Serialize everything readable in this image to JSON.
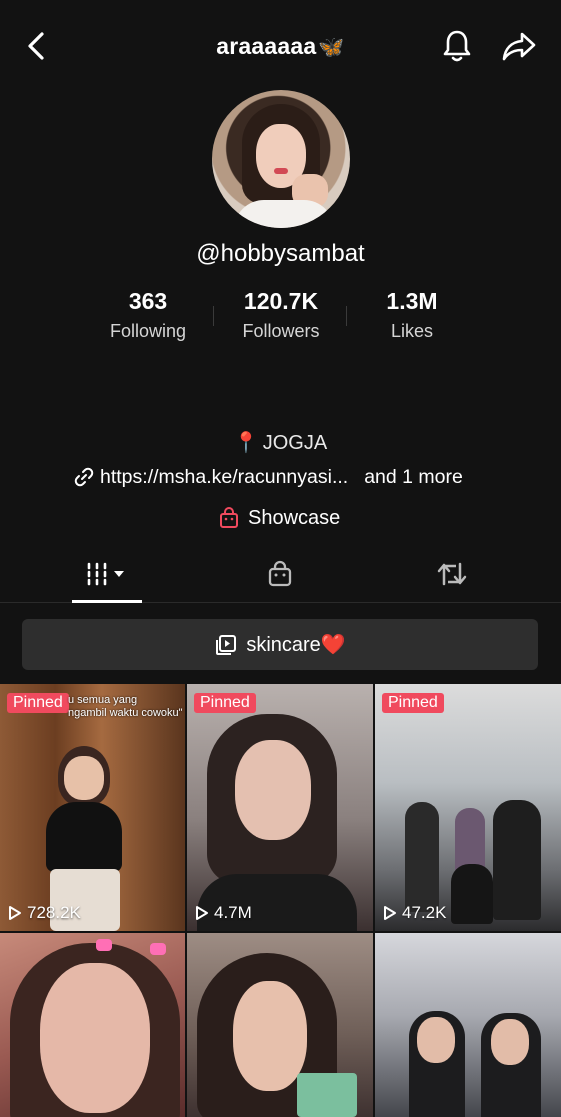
{
  "header": {
    "title": "araaaaaa",
    "title_emoji": "🦋",
    "back_icon": "chevron-left-icon",
    "bell_icon": "bell-icon",
    "share_icon": "share-arrow-icon"
  },
  "profile": {
    "handle": "@hobbysambat",
    "stats": [
      {
        "value": "363",
        "label": "Following"
      },
      {
        "value": "120.7K",
        "label": "Followers"
      },
      {
        "value": "1.3M",
        "label": "Likes"
      }
    ],
    "location_pin": "📍",
    "location": "JOGJA",
    "link": "https://msha.ke/racunnyasi...",
    "link_more": "and 1 more",
    "showcase": "Showcase"
  },
  "tabs": [
    {
      "icon": "videos-grid-icon",
      "selected": true
    },
    {
      "icon": "shop-bag-icon",
      "selected": false
    },
    {
      "icon": "repost-icon",
      "selected": false
    }
  ],
  "playlist": {
    "label": "skincare❤️",
    "icon": "playlist-icon"
  },
  "videos": [
    {
      "pinned": "Pinned",
      "views": "728.2K",
      "caption_line1": "u semua yang",
      "caption_line2": "ngambil waktu cowoku\""
    },
    {
      "pinned": "Pinned",
      "views": "4.7M"
    },
    {
      "pinned": "Pinned",
      "views": "47.2K"
    },
    {},
    {},
    {}
  ],
  "colors": {
    "background": "#121212",
    "accent_red": "#f04a5e",
    "playlist_bg": "#2e2e2e"
  }
}
